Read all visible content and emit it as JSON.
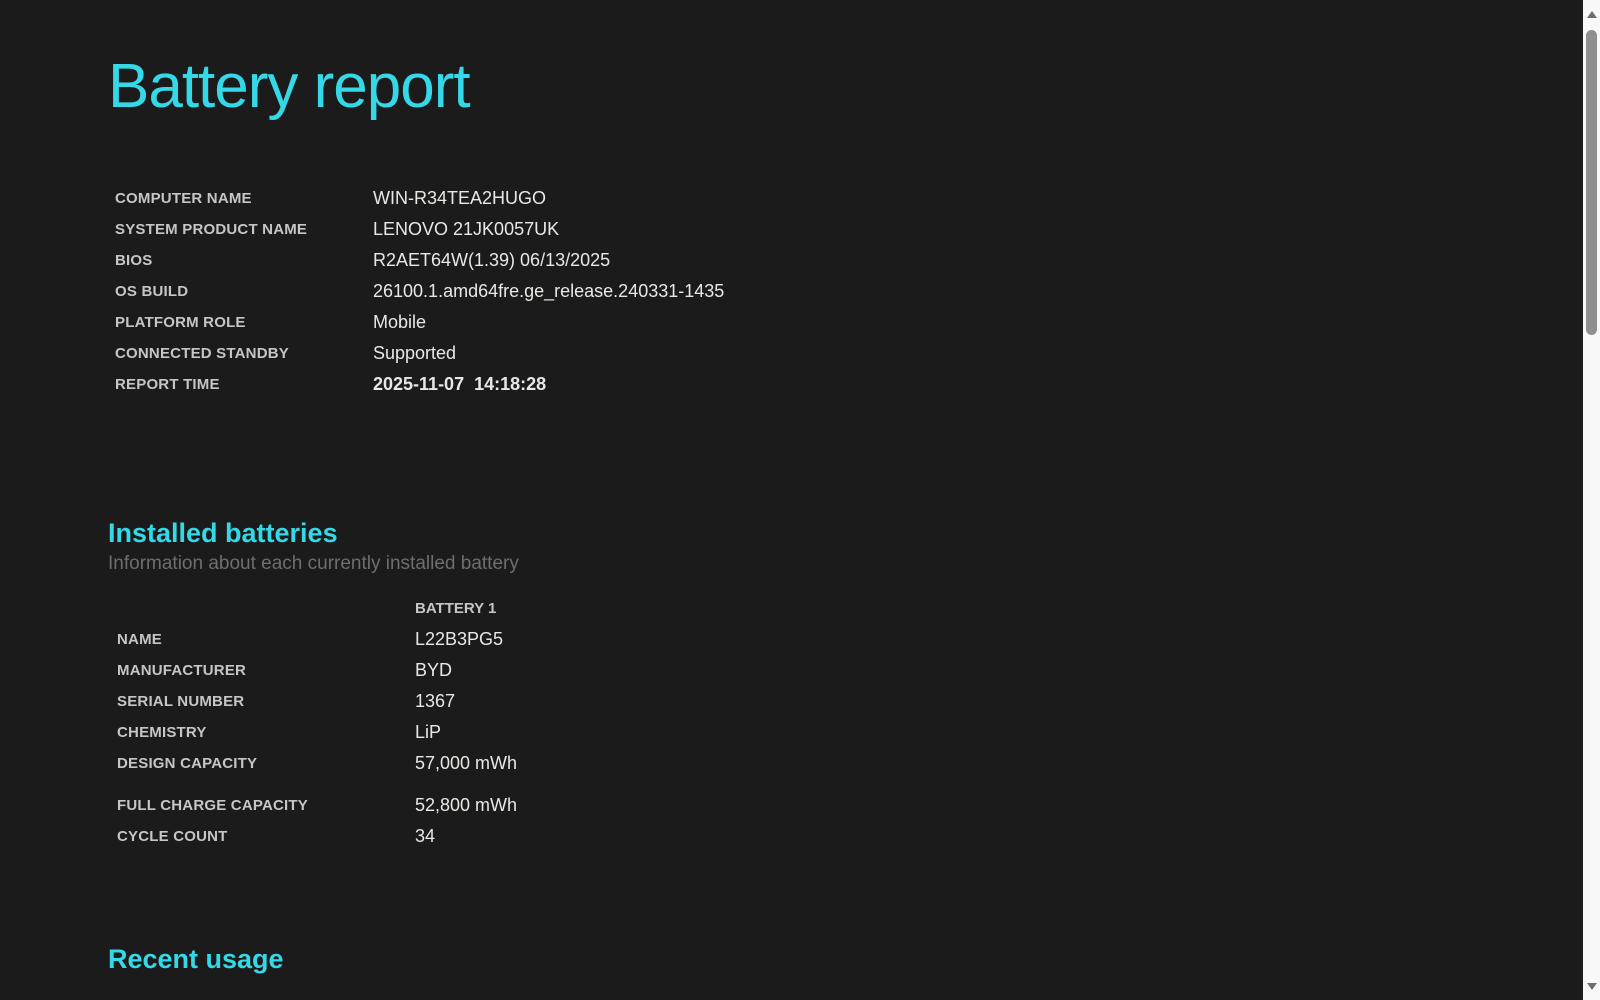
{
  "title": "Battery report",
  "system_info": {
    "rows": [
      {
        "label": "COMPUTER NAME",
        "value": "WIN-R34TEA2HUGO"
      },
      {
        "label": "SYSTEM PRODUCT NAME",
        "value": "LENOVO 21JK0057UK"
      },
      {
        "label": "BIOS",
        "value": "R2AET64W(1.39) 06/13/2025"
      },
      {
        "label": "OS BUILD",
        "value": "26100.1.amd64fre.ge_release.240331-1435"
      },
      {
        "label": "PLATFORM ROLE",
        "value": "Mobile"
      },
      {
        "label": "CONNECTED STANDBY",
        "value": "Supported"
      },
      {
        "label": "REPORT TIME",
        "value": "2025-11-07  14:18:28",
        "bold": true
      }
    ]
  },
  "installed_batteries": {
    "heading": "Installed batteries",
    "subtitle": "Information about each currently installed battery",
    "column_header": "BATTERY 1",
    "rows": [
      {
        "label": "NAME",
        "value": "L22B3PG5"
      },
      {
        "label": "MANUFACTURER",
        "value": "BYD"
      },
      {
        "label": "SERIAL NUMBER",
        "value": "1367"
      },
      {
        "label": "CHEMISTRY",
        "value": "LiP"
      },
      {
        "label": "DESIGN CAPACITY",
        "value": "57,000 mWh"
      },
      {
        "label": "FULL CHARGE CAPACITY",
        "value": "52,800 mWh",
        "gap": true
      },
      {
        "label": "CYCLE COUNT",
        "value": "34"
      }
    ]
  },
  "recent_usage": {
    "heading": "Recent usage"
  },
  "colors": {
    "background": "#1b1b1b",
    "accent": "#35d8e7",
    "label": "#c6c6c6",
    "value": "#eae8e5",
    "subtitle": "#6e6e6e",
    "sb-track": "#f8f8f8",
    "sb-thumb": "#8f8f8f",
    "sb-arrow": "#6e6e6e"
  }
}
